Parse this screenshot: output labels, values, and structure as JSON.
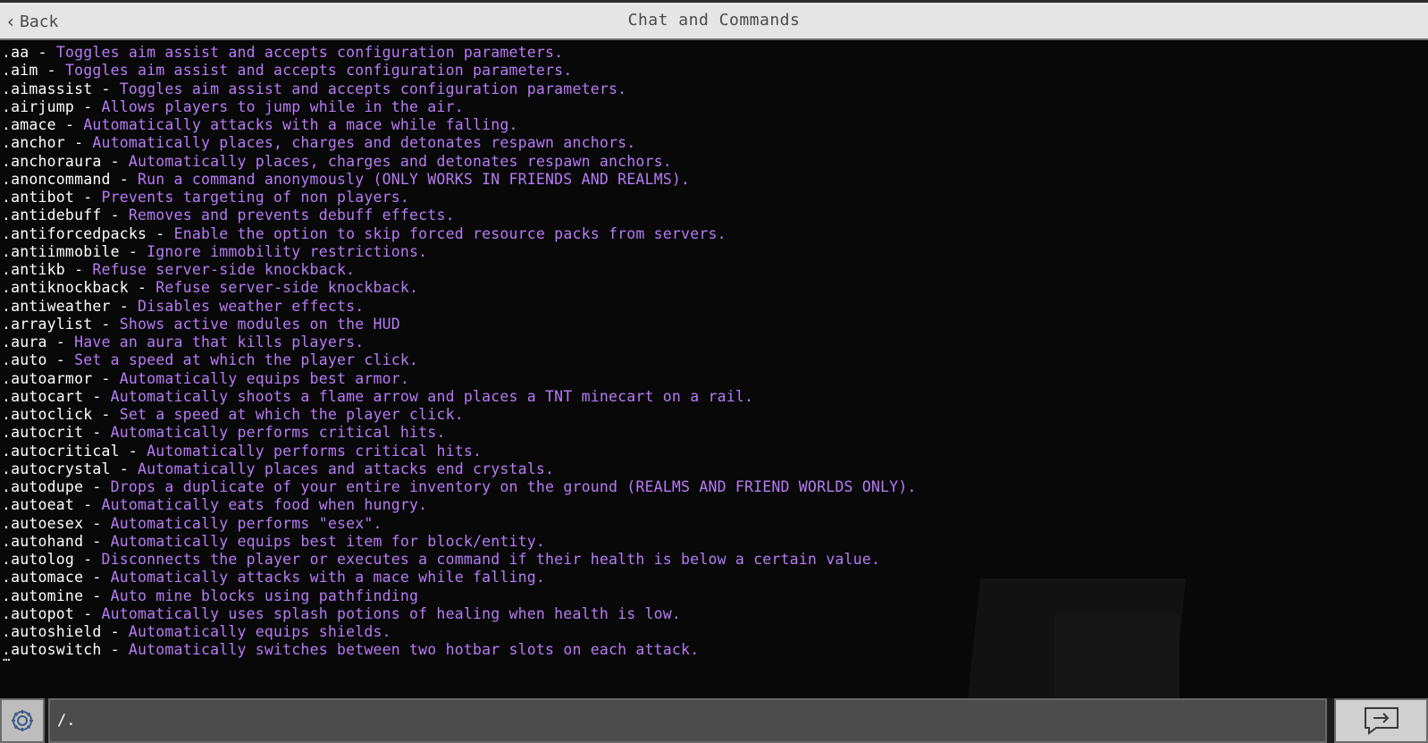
{
  "header": {
    "back_label": "Back",
    "title": "Chat and Commands"
  },
  "colors": {
    "command": "#ffffff",
    "description": "#b77bf5",
    "header_bg": "#e5e5e5",
    "input_bg": "#4c4c4c"
  },
  "icons": {
    "back": "chevron-left-icon",
    "settings": "gear-icon",
    "send": "send-arrow-icon"
  },
  "messages": [
    {
      "cmd": ".aa",
      "desc": "Toggles aim assist and accepts configuration parameters."
    },
    {
      "cmd": ".aim",
      "desc": "Toggles aim assist and accepts configuration parameters."
    },
    {
      "cmd": ".aimassist",
      "desc": "Toggles aim assist and accepts configuration parameters."
    },
    {
      "cmd": ".airjump",
      "desc": "Allows players to jump while in the air."
    },
    {
      "cmd": ".amace",
      "desc": "Automatically attacks with a mace while falling."
    },
    {
      "cmd": ".anchor",
      "desc": "Automatically places, charges and detonates respawn anchors."
    },
    {
      "cmd": ".anchoraura",
      "desc": "Automatically places, charges and detonates respawn anchors."
    },
    {
      "cmd": ".anoncommand",
      "desc": "Run a command anonymously (ONLY WORKS IN FRIENDS AND REALMS)."
    },
    {
      "cmd": ".antibot",
      "desc": "Prevents targeting of non players."
    },
    {
      "cmd": ".antidebuff",
      "desc": "Removes and prevents debuff effects."
    },
    {
      "cmd": ".antiforcedpacks",
      "desc": "Enable the option to skip forced resource packs from servers."
    },
    {
      "cmd": ".antiimmobile",
      "desc": "Ignore immobility restrictions."
    },
    {
      "cmd": ".antikb",
      "desc": "Refuse server-side knockback."
    },
    {
      "cmd": ".antiknockback",
      "desc": "Refuse server-side knockback."
    },
    {
      "cmd": ".antiweather",
      "desc": "Disables weather effects."
    },
    {
      "cmd": ".arraylist",
      "desc": "Shows active modules on the HUD"
    },
    {
      "cmd": ".aura",
      "desc": "Have an aura that kills players."
    },
    {
      "cmd": ".auto",
      "desc": "Set a speed at which the player click."
    },
    {
      "cmd": ".autoarmor",
      "desc": "Automatically equips best armor."
    },
    {
      "cmd": ".autocart",
      "desc": "Automatically shoots a flame arrow and places a TNT minecart on a rail."
    },
    {
      "cmd": ".autoclick",
      "desc": "Set a speed at which the player click."
    },
    {
      "cmd": ".autocrit",
      "desc": "Automatically performs critical hits."
    },
    {
      "cmd": ".autocritical",
      "desc": "Automatically performs critical hits."
    },
    {
      "cmd": ".autocrystal",
      "desc": "Automatically places and attacks end crystals."
    },
    {
      "cmd": ".autodupe",
      "desc": "Drops a duplicate of your entire inventory on the ground (REALMS AND FRIEND WORLDS ONLY)."
    },
    {
      "cmd": ".autoeat",
      "desc": "Automatically eats food when hungry."
    },
    {
      "cmd": ".autoesex",
      "desc": "Automatically performs \"esex\"."
    },
    {
      "cmd": ".autohand",
      "desc": "Automatically equips best item for block/entity."
    },
    {
      "cmd": ".autolog",
      "desc": "Disconnects the player or executes a command if their health is below a certain value."
    },
    {
      "cmd": ".automace",
      "desc": "Automatically attacks with a mace while falling."
    },
    {
      "cmd": ".automine",
      "desc": "Auto mine blocks using pathfinding"
    },
    {
      "cmd": ".autopot",
      "desc": "Automatically uses splash potions of healing when health is low."
    },
    {
      "cmd": ".autoshield",
      "desc": "Automatically equips shields."
    },
    {
      "cmd": ".autoswitch",
      "desc": "Automatically switches between two hotbar slots on each attack."
    }
  ],
  "separator": " - ",
  "overflow_indicator": "…",
  "input": {
    "value": "/."
  }
}
